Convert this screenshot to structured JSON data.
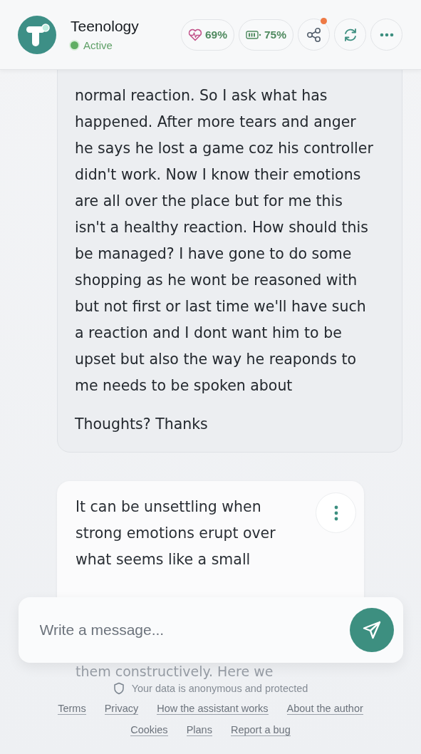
{
  "header": {
    "title": "Teenology",
    "status": {
      "label": "Active",
      "active": true
    }
  },
  "stats": [
    {
      "kind": "health",
      "value": "69%"
    },
    {
      "kind": "battery",
      "value": "75%"
    }
  ],
  "actions": {
    "share_notification": true
  },
  "messages": [
    {
      "kind": "user",
      "paragraphs": [
        "normal reaction. So I ask what has happened. After more tears and anger he says he lost a game coz his controller didn't work. Now I know their emotions are all over the place but for me this isn't a healthy reaction. How should this be managed? I have gone to do some shopping as he wont be reasoned with but not first or last time we'll have such a reaction and I dont want him to be upset but also the way he reaponds to me needs to be spoken about",
        "Thoughts? Thanks"
      ]
    },
    {
      "kind": "assistant",
      "text": "It can be unsettling when strong emotions erupt over what seems like a small",
      "faded_text": "them constructively. Here we"
    }
  ],
  "composer": {
    "placeholder": "Write a message..."
  },
  "privacy_note": "Your data is anonymous and protected",
  "footer_links": [
    [
      "Terms",
      "Privacy",
      "How the assistant works",
      "About the author"
    ],
    [
      "Cookies",
      "Plans",
      "Report a bug"
    ]
  ]
}
